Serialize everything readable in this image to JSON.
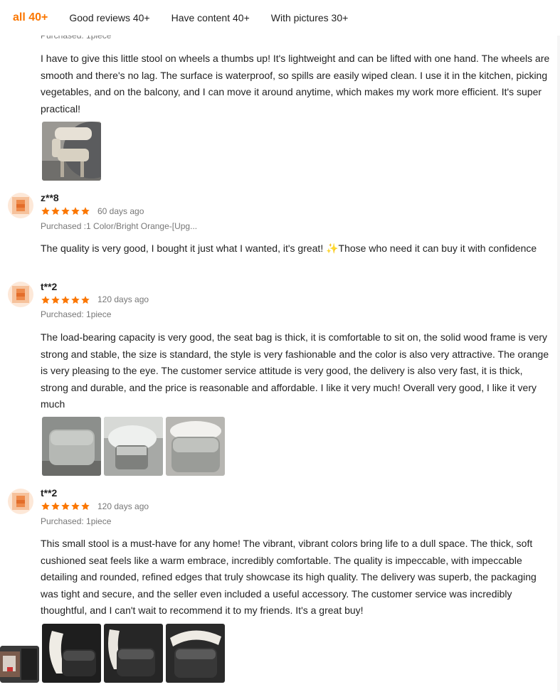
{
  "tabs": [
    {
      "label": "all 40+"
    },
    {
      "label": "Good reviews 40+"
    },
    {
      "label": "Have content 40+"
    },
    {
      "label": "With pictures 30+"
    }
  ],
  "top_partial": {
    "purchased": "Purchased:  1piece",
    "body": "I have to give this little stool on wheels a thumbs up! It's lightweight and can be lifted with one hand. The wheels are smooth and there's no lag. The surface is waterproof, so spills are easily wiped clean. I use it in the kitchen, picking vegetables, and on the balcony, and I can move it around anytime, which makes my work more efficient. It's super practical!"
  },
  "reviews": [
    {
      "name": "z**8",
      "rating": 5,
      "date": "60 days ago",
      "purchased": "Purchased  :1 Color/Bright Orange-[Upg...",
      "body": "The quality is very good, I bought it just what I wanted, it's great! ✨Those who need it can buy it with confidence"
    },
    {
      "name": "t**2",
      "rating": 5,
      "date": "120 days ago",
      "purchased": "Purchased:  1piece",
      "body": "The load-bearing capacity is very good, the seat bag is thick, it is comfortable to sit on, the solid wood frame is very strong and stable, the size is standard, the style is very fashionable and the color is also very attractive. The orange is very pleasing to the eye. The customer service attitude is very good, the delivery is also very fast, it is thick, strong and durable, and the price is reasonable and affordable. I like it very much! Overall very good, I like it very much"
    },
    {
      "name": "t**2",
      "rating": 5,
      "date": "120 days ago",
      "purchased": "Purchased:  1piece",
      "body": "This small stool is a must-have for any home! The vibrant, vibrant colors bring life to a dull space. The thick, soft cushioned seat feels like a warm embrace, incredibly comfortable. The quality is impeccable, with impeccable detailing and rounded, refined edges that truly showcase its high quality. The delivery was superb, the packaging was tight and secure, and the seller even included a useful accessory. The customer service was incredibly thoughtful, and I can't wait to recommend it to my friends. It's a great buy!"
    }
  ],
  "colors": {
    "accent": "#fb7701",
    "star": "#fb7701",
    "muted": "#777777"
  },
  "icons": [
    "star-icon"
  ]
}
